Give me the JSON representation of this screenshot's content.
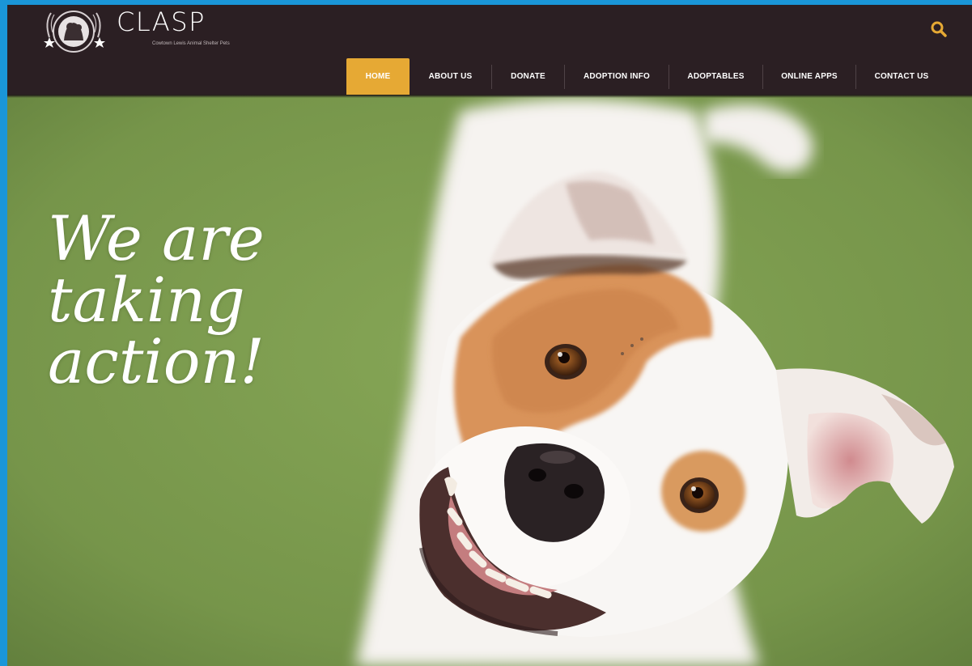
{
  "brand": {
    "title": "CLASP",
    "tagline": "Cowtown Lewis Animal Shelter Pets"
  },
  "header": {
    "search_icon": "search-icon",
    "nav": [
      {
        "label": "HOME",
        "active": true
      },
      {
        "label": "ABOUT US",
        "active": false
      },
      {
        "label": "DONATE",
        "active": false
      },
      {
        "label": "ADOPTION INFO",
        "active": false
      },
      {
        "label": "ADOPTABLES",
        "active": false
      },
      {
        "label": "ONLINE APPS",
        "active": false
      },
      {
        "label": "CONTACT US",
        "active": false
      }
    ]
  },
  "hero": {
    "headline_lines": [
      "We are",
      "taking",
      "action!"
    ]
  },
  "colors": {
    "page_border": "#1a96d8",
    "header_bg": "#2b1f23",
    "nav_active_bg": "#e6a934",
    "search_icon": "#e6a934",
    "hero_grass": "#7c9a4e"
  }
}
